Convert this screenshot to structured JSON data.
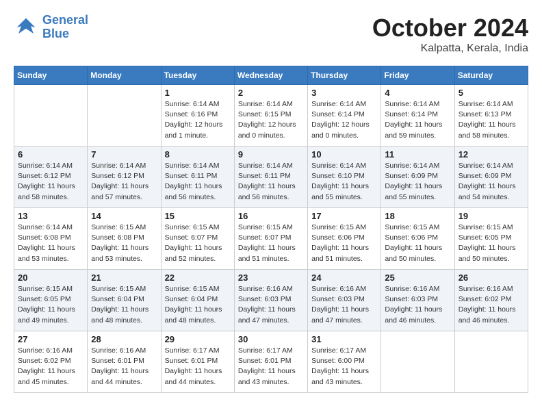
{
  "header": {
    "logo_line1": "General",
    "logo_line2": "Blue",
    "month": "October 2024",
    "location": "Kalpatta, Kerala, India"
  },
  "weekdays": [
    "Sunday",
    "Monday",
    "Tuesday",
    "Wednesday",
    "Thursday",
    "Friday",
    "Saturday"
  ],
  "weeks": [
    [
      {
        "day": "",
        "info": ""
      },
      {
        "day": "",
        "info": ""
      },
      {
        "day": "1",
        "info": "Sunrise: 6:14 AM\nSunset: 6:16 PM\nDaylight: 12 hours\nand 1 minute."
      },
      {
        "day": "2",
        "info": "Sunrise: 6:14 AM\nSunset: 6:15 PM\nDaylight: 12 hours\nand 0 minutes."
      },
      {
        "day": "3",
        "info": "Sunrise: 6:14 AM\nSunset: 6:14 PM\nDaylight: 12 hours\nand 0 minutes."
      },
      {
        "day": "4",
        "info": "Sunrise: 6:14 AM\nSunset: 6:14 PM\nDaylight: 11 hours\nand 59 minutes."
      },
      {
        "day": "5",
        "info": "Sunrise: 6:14 AM\nSunset: 6:13 PM\nDaylight: 11 hours\nand 58 minutes."
      }
    ],
    [
      {
        "day": "6",
        "info": "Sunrise: 6:14 AM\nSunset: 6:12 PM\nDaylight: 11 hours\nand 58 minutes."
      },
      {
        "day": "7",
        "info": "Sunrise: 6:14 AM\nSunset: 6:12 PM\nDaylight: 11 hours\nand 57 minutes."
      },
      {
        "day": "8",
        "info": "Sunrise: 6:14 AM\nSunset: 6:11 PM\nDaylight: 11 hours\nand 56 minutes."
      },
      {
        "day": "9",
        "info": "Sunrise: 6:14 AM\nSunset: 6:11 PM\nDaylight: 11 hours\nand 56 minutes."
      },
      {
        "day": "10",
        "info": "Sunrise: 6:14 AM\nSunset: 6:10 PM\nDaylight: 11 hours\nand 55 minutes."
      },
      {
        "day": "11",
        "info": "Sunrise: 6:14 AM\nSunset: 6:09 PM\nDaylight: 11 hours\nand 55 minutes."
      },
      {
        "day": "12",
        "info": "Sunrise: 6:14 AM\nSunset: 6:09 PM\nDaylight: 11 hours\nand 54 minutes."
      }
    ],
    [
      {
        "day": "13",
        "info": "Sunrise: 6:14 AM\nSunset: 6:08 PM\nDaylight: 11 hours\nand 53 minutes."
      },
      {
        "day": "14",
        "info": "Sunrise: 6:15 AM\nSunset: 6:08 PM\nDaylight: 11 hours\nand 53 minutes."
      },
      {
        "day": "15",
        "info": "Sunrise: 6:15 AM\nSunset: 6:07 PM\nDaylight: 11 hours\nand 52 minutes."
      },
      {
        "day": "16",
        "info": "Sunrise: 6:15 AM\nSunset: 6:07 PM\nDaylight: 11 hours\nand 51 minutes."
      },
      {
        "day": "17",
        "info": "Sunrise: 6:15 AM\nSunset: 6:06 PM\nDaylight: 11 hours\nand 51 minutes."
      },
      {
        "day": "18",
        "info": "Sunrise: 6:15 AM\nSunset: 6:06 PM\nDaylight: 11 hours\nand 50 minutes."
      },
      {
        "day": "19",
        "info": "Sunrise: 6:15 AM\nSunset: 6:05 PM\nDaylight: 11 hours\nand 50 minutes."
      }
    ],
    [
      {
        "day": "20",
        "info": "Sunrise: 6:15 AM\nSunset: 6:05 PM\nDaylight: 11 hours\nand 49 minutes."
      },
      {
        "day": "21",
        "info": "Sunrise: 6:15 AM\nSunset: 6:04 PM\nDaylight: 11 hours\nand 48 minutes."
      },
      {
        "day": "22",
        "info": "Sunrise: 6:15 AM\nSunset: 6:04 PM\nDaylight: 11 hours\nand 48 minutes."
      },
      {
        "day": "23",
        "info": "Sunrise: 6:16 AM\nSunset: 6:03 PM\nDaylight: 11 hours\nand 47 minutes."
      },
      {
        "day": "24",
        "info": "Sunrise: 6:16 AM\nSunset: 6:03 PM\nDaylight: 11 hours\nand 47 minutes."
      },
      {
        "day": "25",
        "info": "Sunrise: 6:16 AM\nSunset: 6:03 PM\nDaylight: 11 hours\nand 46 minutes."
      },
      {
        "day": "26",
        "info": "Sunrise: 6:16 AM\nSunset: 6:02 PM\nDaylight: 11 hours\nand 46 minutes."
      }
    ],
    [
      {
        "day": "27",
        "info": "Sunrise: 6:16 AM\nSunset: 6:02 PM\nDaylight: 11 hours\nand 45 minutes."
      },
      {
        "day": "28",
        "info": "Sunrise: 6:16 AM\nSunset: 6:01 PM\nDaylight: 11 hours\nand 44 minutes."
      },
      {
        "day": "29",
        "info": "Sunrise: 6:17 AM\nSunset: 6:01 PM\nDaylight: 11 hours\nand 44 minutes."
      },
      {
        "day": "30",
        "info": "Sunrise: 6:17 AM\nSunset: 6:01 PM\nDaylight: 11 hours\nand 43 minutes."
      },
      {
        "day": "31",
        "info": "Sunrise: 6:17 AM\nSunset: 6:00 PM\nDaylight: 11 hours\nand 43 minutes."
      },
      {
        "day": "",
        "info": ""
      },
      {
        "day": "",
        "info": ""
      }
    ]
  ]
}
